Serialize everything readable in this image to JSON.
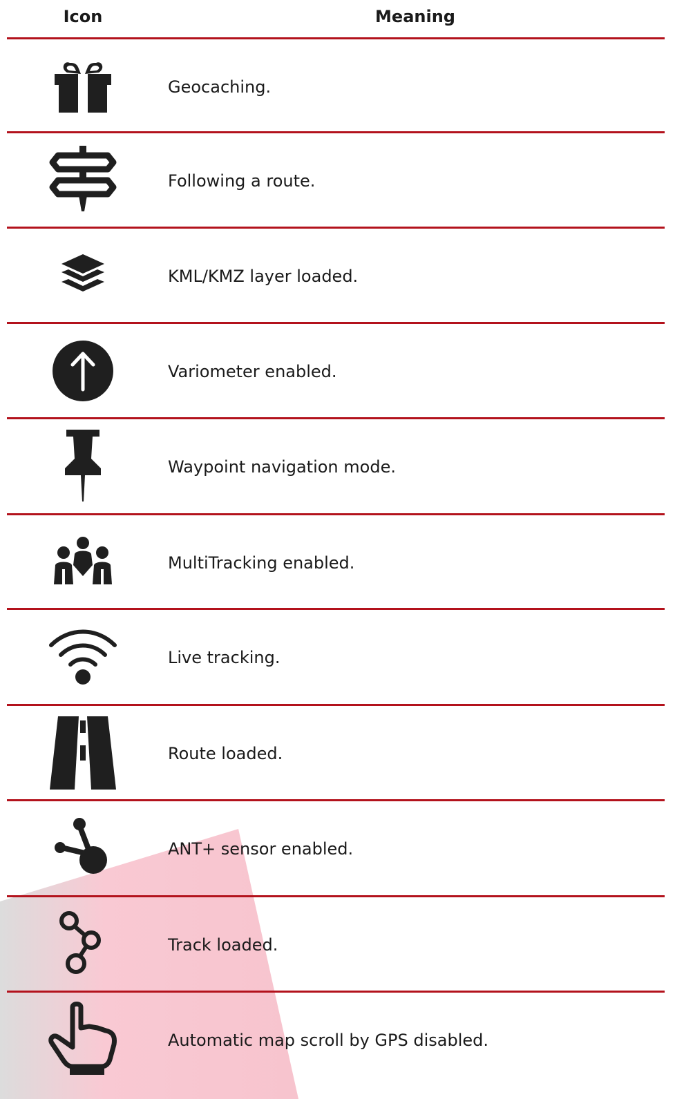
{
  "colors": {
    "rule": "#b3121c",
    "icon": "#1f1f1f",
    "watermark": "#f8c6d0"
  },
  "header": {
    "icon_label": "Icon",
    "meaning_label": "Meaning"
  },
  "rows": [
    {
      "icon": "gift-icon",
      "meaning": "Geocaching."
    },
    {
      "icon": "signpost-icon",
      "meaning": "Following a route."
    },
    {
      "icon": "layers-icon",
      "meaning": "KML/KMZ layer loaded."
    },
    {
      "icon": "arrow-up-circle-icon",
      "meaning": "Variometer enabled."
    },
    {
      "icon": "pushpin-icon",
      "meaning": "Waypoint navigation mode."
    },
    {
      "icon": "group-icon",
      "meaning": "MultiTracking enabled."
    },
    {
      "icon": "wifi-icon",
      "meaning": "Live tracking."
    },
    {
      "icon": "road-icon",
      "meaning": "Route loaded."
    },
    {
      "icon": "ant-sensor-icon",
      "meaning": "ANT+ sensor enabled."
    },
    {
      "icon": "track-nodes-icon",
      "meaning": "Track loaded."
    },
    {
      "icon": "pointing-hand-icon",
      "meaning": "Automatic map scroll by GPS disabled."
    }
  ]
}
